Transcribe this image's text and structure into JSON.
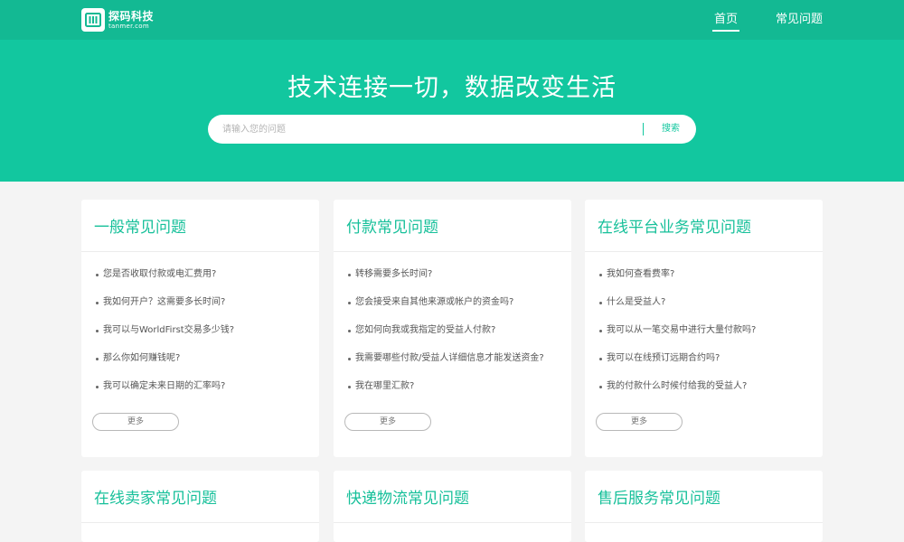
{
  "header": {
    "logo_name": "探码科技",
    "logo_domain": "tanmer.com",
    "nav": [
      "首页",
      "常见问题"
    ]
  },
  "hero": {
    "title": "技术连接一切，数据改变生活",
    "search_placeholder": "请输入您的问题",
    "search_button": "搜索"
  },
  "cards": [
    {
      "title": "一般常见问题",
      "items": [
        "您是否收取付款或电汇费用?",
        "我如何开户？这需要多长时间?",
        "我可以与WorldFirst交易多少钱?",
        "那么你如何赚钱呢?",
        "我可以确定未来日期的汇率吗?"
      ],
      "more": "更多"
    },
    {
      "title": "付款常见问题",
      "items": [
        "转移需要多长时间?",
        "您会接受来自其他来源或帐户的资金吗?",
        "您如何向我或我指定的受益人付款?",
        "我需要哪些付款/受益人详细信息才能发送资金?",
        "我在哪里汇款?"
      ],
      "more": "更多"
    },
    {
      "title": "在线平台业务常见问题",
      "items": [
        "我如何查看费率?",
        "什么是受益人?",
        "我可以从一笔交易中进行大量付款吗?",
        "我可以在线预订远期合约吗?",
        "我的付款什么时候付给我的受益人?"
      ],
      "more": "更多"
    },
    {
      "title": "在线卖家常见问题"
    },
    {
      "title": "快递物流常见问题"
    },
    {
      "title": "售后服务常见问题"
    }
  ],
  "colors": {
    "topbar": "#13b993",
    "hero": "#12c79f",
    "accent": "#17c09a",
    "page_bg": "#f4f4f4"
  }
}
